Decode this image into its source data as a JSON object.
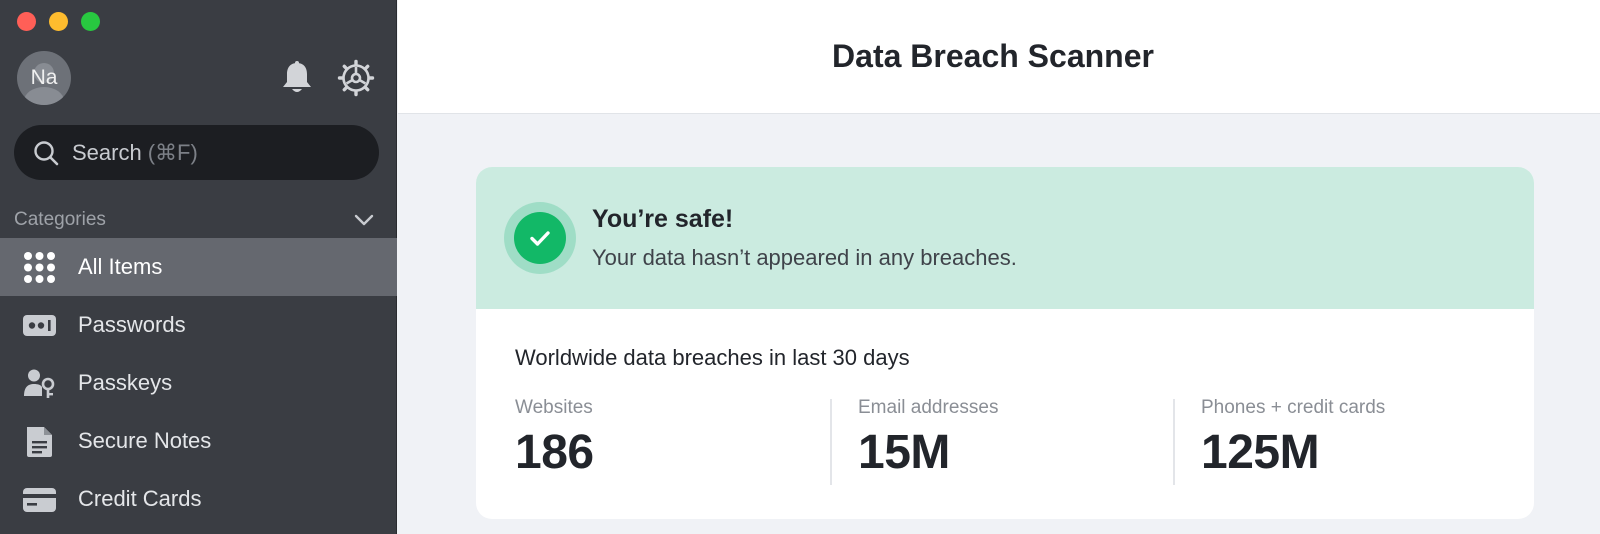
{
  "sidebar": {
    "avatar_initials": "Na",
    "search": {
      "label": "Search",
      "shortcut": "(⌘F)"
    },
    "categories_title": "Categories",
    "items": [
      {
        "label": "All Items",
        "icon": "grid-icon",
        "active": true
      },
      {
        "label": "Passwords",
        "icon": "password-icon",
        "active": false
      },
      {
        "label": "Passkeys",
        "icon": "passkey-icon",
        "active": false
      },
      {
        "label": "Secure Notes",
        "icon": "note-icon",
        "active": false
      },
      {
        "label": "Credit Cards",
        "icon": "credit-card-icon",
        "active": false
      }
    ]
  },
  "header": {
    "title": "Data Breach Scanner"
  },
  "status": {
    "title": "You’re safe!",
    "message": "Your data hasn’t appeared in any breaches."
  },
  "stats": {
    "title": "Worldwide data breaches in last 30 days",
    "items": [
      {
        "label": "Websites",
        "value": "186"
      },
      {
        "label": "Email addresses",
        "value": "15M"
      },
      {
        "label": "Phones + credit cards",
        "value": "125M"
      }
    ]
  },
  "colors": {
    "sidebar_bg": "#3a3d43",
    "active_item_bg": "#65686f",
    "safe_banner_bg": "#cbebe0",
    "check_green": "#12b867"
  }
}
